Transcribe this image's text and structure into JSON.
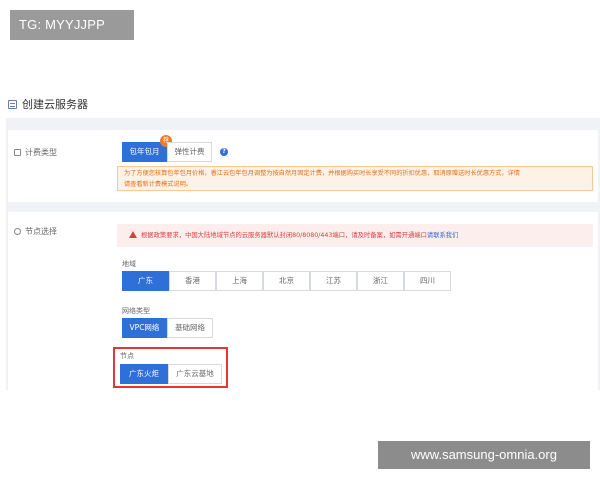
{
  "watermarks": {
    "top_left": "TG: MYYJJPP",
    "bottom_right": "www.samsung-omnia.org"
  },
  "page": {
    "title": "创建云服务器",
    "title_icon": "server-icon"
  },
  "billing": {
    "label": "计费类型",
    "options": [
      {
        "label": "包年包月",
        "selected": true
      },
      {
        "label": "弹性计费",
        "selected": false
      }
    ],
    "hot_badge": "荐",
    "help_icon": "?",
    "notice_line1": "为了方便您核算包年包月价格，睿江云包年包月调整为按自然月固定计费，并根据购买时长享受不同的折扣优惠，取消原赠送时长优惠方式，详情",
    "notice_line2": "请查看新计费模式说明。"
  },
  "node_selection": {
    "label": "节点选择",
    "notice_text": "根据政策要求，中国大陆地域节点的云服务器默认封闭80/8080/443端口，请及时备案，如需开通端口",
    "notice_link": "请联系我们",
    "region": {
      "label": "地域",
      "options": [
        {
          "label": "广东",
          "selected": true
        },
        {
          "label": "香港",
          "selected": false
        },
        {
          "label": "上海",
          "selected": false
        },
        {
          "label": "北京",
          "selected": false
        },
        {
          "label": "江苏",
          "selected": false
        },
        {
          "label": "浙江",
          "selected": false
        },
        {
          "label": "四川",
          "selected": false
        }
      ]
    },
    "network": {
      "label": "网络类型",
      "options": [
        {
          "label": "VPC网络",
          "selected": true
        },
        {
          "label": "基础网络",
          "selected": false
        }
      ]
    },
    "node": {
      "label": "节点",
      "options": [
        {
          "label": "广东火炬",
          "selected": true
        },
        {
          "label": "广东云基地",
          "selected": false
        }
      ]
    }
  },
  "colors": {
    "primary": "#2f6fd8",
    "warning": "#e07020",
    "danger": "#d84040",
    "highlight_border": "#e03838"
  }
}
